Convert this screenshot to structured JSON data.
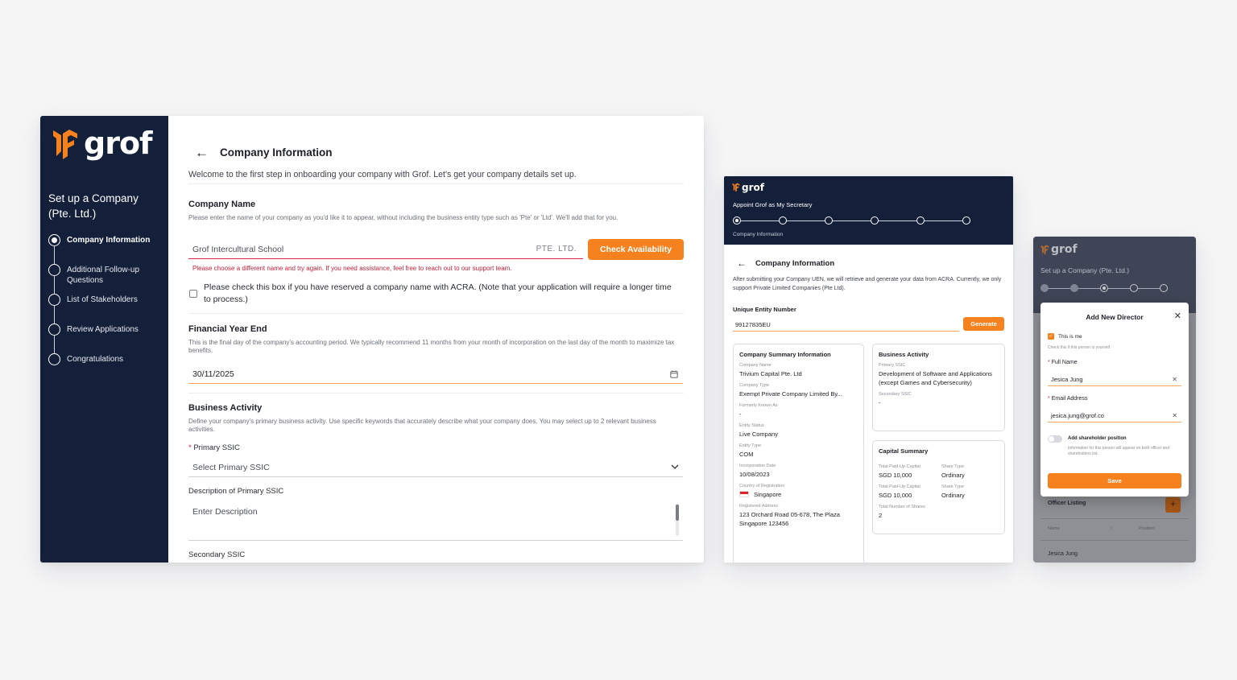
{
  "brand": {
    "name": "grof",
    "accent": "#f5821f",
    "navy": "#141f3a",
    "logo_icon": "grof-mark-icon"
  },
  "card1": {
    "sidebar": {
      "title": "Set up a Company (Pte. Ltd.)",
      "steps": [
        {
          "label": "Company Information",
          "active": true
        },
        {
          "label": "Additional Follow-up Questions",
          "active": false
        },
        {
          "label": "List of Stakeholders",
          "active": false
        },
        {
          "label": "Review Applications",
          "active": false
        },
        {
          "label": "Congratulations",
          "active": false
        }
      ]
    },
    "header": {
      "title": "Company Information",
      "back_icon": "arrow-left-icon"
    },
    "intro": "Welcome to the first step in onboarding your company with Grof. Let's get your company details set up.",
    "company_name": {
      "title": "Company Name",
      "desc": "Please enter the name of your company as you'd like it to appear, without including the business entity type such as 'Pte' or 'Ltd'. We'll add that for you.",
      "value": "Grof Intercultural School",
      "suffix": "PTE. LTD.",
      "button": "Check Availability",
      "error": "Please choose a different name and try again. If you need assistance, feel free to reach out to our support team.",
      "checkbox_label": "Please check this box if you have reserved a company name with ACRA. (Note that your application will require a longer time to process.)"
    },
    "financial_year": {
      "title": "Financial Year End",
      "desc": "This is the final day of the company's accounting period. We typically recommend 11 months from your month of incorporation on the last day of the month to maximize tax benefits.",
      "value": "30/11/2025",
      "icon": "calendar-icon"
    },
    "business_activity": {
      "title": "Business Activity",
      "desc": "Define your company's primary business activity. Use specific keywords that accurately describe what your company does. You may select up to 2 relevant business activities.",
      "primary_label": "Primary SSIC",
      "primary_placeholder": "Select Primary SSIC",
      "desc_label": "Description of Primary SSIC",
      "desc_placeholder": "Enter Description",
      "secondary_label": "Secondary SSIC"
    }
  },
  "card2": {
    "top_title": "Appoint Grof as My Secretary",
    "step_caption": "Company Information",
    "header": "Company Information",
    "desc": "After submitting your Company UEN, we will retrieve and generate your data from ACRA. Currently, we only support Private Limited Companies (Pte Ltd).",
    "uen_label": "Unique Entity Number",
    "uen_value": "99127835EU",
    "generate": "Generate",
    "summary": {
      "title": "Company Summary Information",
      "fields": [
        {
          "k": "Company Name",
          "v": "Trivium Capital Pte. Ltd"
        },
        {
          "k": "Company Type",
          "v": "Exempt Private Company Limited By..."
        },
        {
          "k": "Formerly Known As",
          "v": "-"
        },
        {
          "k": "Entity Status",
          "v": "Live Company"
        },
        {
          "k": "Entity Type",
          "v": "COM"
        },
        {
          "k": "Incorporation Date",
          "v": "10/08/2023"
        },
        {
          "k": "Country of Registration",
          "v": "Singapore"
        },
        {
          "k": "Registered Address",
          "v": "123 Orchard Road 05-678, The Plaza Singapore 123456"
        }
      ]
    },
    "business": {
      "title": "Business Activity",
      "primary_k": "Primary SSIC",
      "primary_v": "Development of Software and Applications (except Games and Cybersecurity)",
      "secondary_k": "Secondary SSIC",
      "secondary_v": "-"
    },
    "capital": {
      "title": "Capital Summary",
      "row1": {
        "k1": "Total Paid-Up Capital",
        "v1": "SGD 10,000",
        "k2": "Share Type",
        "v2": "Ordinary"
      },
      "row2": {
        "k1": "Total Paid-Up Capital",
        "v1": "SGD 10,000",
        "k2": "Share Type",
        "v2": "Ordinary"
      },
      "shares_k": "Total Number of Shares",
      "shares_v": "2"
    }
  },
  "card3": {
    "top_title": "Set up a Company (Pte. Ltd.)",
    "modal": {
      "title": "Add New Director",
      "this_is_me": "This is me",
      "this_is_me_hint": "Check this if this person is yourself.",
      "full_name_label": "Full Name",
      "full_name": "Jesica Jung",
      "email_label": "Email Address",
      "email": "jesica.jung@grof.co",
      "shareholder_label": "Add shareholder position",
      "shareholder_hint": "Information for this person will appear on both officer and shareholders list.",
      "save": "Save"
    },
    "officer_listing": "Officer Listing",
    "col_name": "Name",
    "col_position": "Position",
    "row_name": "Jesica Jung"
  }
}
